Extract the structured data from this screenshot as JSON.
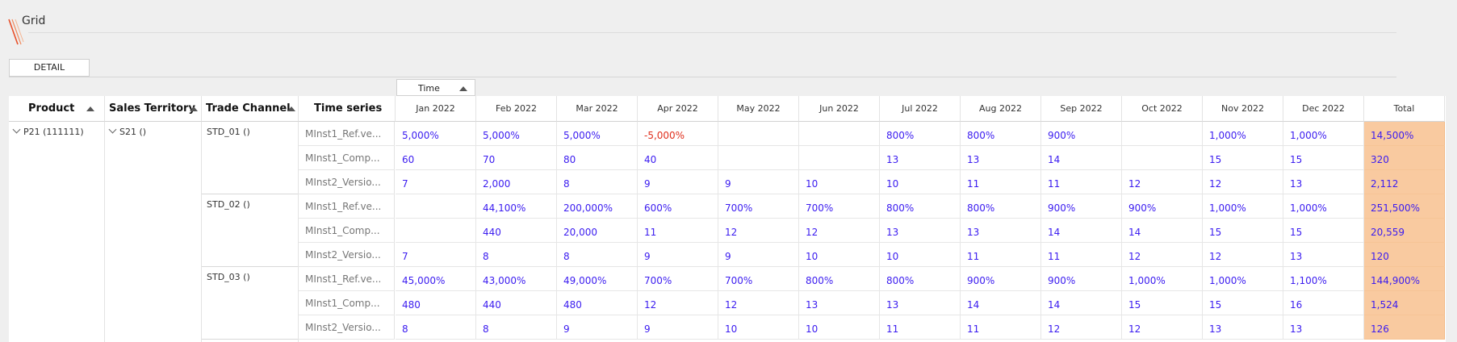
{
  "app": {
    "title": "Grid",
    "detail_tab_label": "DETAIL",
    "time_chip_label": "Time"
  },
  "columns": {
    "product": "Product",
    "sales_territory": "Sales Territory",
    "trade_channel": "Trade Channel",
    "time_series": "Time series",
    "months": [
      "Jan 2022",
      "Feb 2022",
      "Mar 2022",
      "Apr 2022",
      "May 2022",
      "Jun 2022",
      "Jul 2022",
      "Aug 2022",
      "Sep 2022",
      "Oct 2022",
      "Nov 2022",
      "Dec 2022"
    ],
    "total": "Total"
  },
  "product": {
    "label": "P21 (111111)"
  },
  "territory": {
    "label": "S21 ()"
  },
  "channels": [
    {
      "label": "STD_01 ()",
      "rows": [
        {
          "series": "MInst1_Ref.ve...",
          "values": [
            "5,000%",
            "5,000%",
            "5,000%",
            "-5,000%",
            "",
            "",
            "800%",
            "800%",
            "900%",
            "",
            "1,000%",
            "1,000%"
          ],
          "total": "14,500%"
        },
        {
          "series": "MInst1_Comp...",
          "values": [
            "60",
            "70",
            "80",
            "40",
            "",
            "",
            "13",
            "13",
            "14",
            "",
            "15",
            "15"
          ],
          "total": "320"
        },
        {
          "series": "MInst2_Versio...",
          "values": [
            "7",
            "2,000",
            "8",
            "9",
            "9",
            "10",
            "10",
            "11",
            "11",
            "12",
            "12",
            "13"
          ],
          "total": "2,112"
        }
      ]
    },
    {
      "label": "STD_02 ()",
      "rows": [
        {
          "series": "MInst1_Ref.ve...",
          "values": [
            "",
            "44,100%",
            "200,000%",
            "600%",
            "700%",
            "700%",
            "800%",
            "800%",
            "900%",
            "900%",
            "1,000%",
            "1,000%"
          ],
          "total": "251,500%"
        },
        {
          "series": "MInst1_Comp...",
          "values": [
            "",
            "440",
            "20,000",
            "11",
            "12",
            "12",
            "13",
            "13",
            "14",
            "14",
            "15",
            "15"
          ],
          "total": "20,559"
        },
        {
          "series": "MInst2_Versio...",
          "values": [
            "7",
            "8",
            "8",
            "9",
            "9",
            "10",
            "10",
            "11",
            "11",
            "12",
            "12",
            "13"
          ],
          "total": "120"
        }
      ]
    },
    {
      "label": "STD_03 ()",
      "rows": [
        {
          "series": "MInst1_Ref.ve...",
          "values": [
            "45,000%",
            "43,000%",
            "49,000%",
            "700%",
            "700%",
            "800%",
            "800%",
            "900%",
            "900%",
            "1,000%",
            "1,000%",
            "1,100%"
          ],
          "total": "144,900%"
        },
        {
          "series": "MInst1_Comp...",
          "values": [
            "480",
            "440",
            "480",
            "12",
            "12",
            "13",
            "13",
            "14",
            "14",
            "15",
            "15",
            "16"
          ],
          "total": "1,524"
        },
        {
          "series": "MInst2_Versio...",
          "values": [
            "8",
            "8",
            "9",
            "9",
            "10",
            "10",
            "11",
            "11",
            "12",
            "12",
            "13",
            "13"
          ],
          "total": "126"
        }
      ]
    }
  ],
  "colors": {
    "value_text": "#3b1cf0",
    "negative_text": "#e0301e",
    "total_background": "#f9caa0",
    "logo_accent": "#e8502a"
  },
  "icons": {
    "logo": "brand-slash-icon",
    "sort": "sort-ascending-icon",
    "expand": "chevron-down-icon"
  }
}
